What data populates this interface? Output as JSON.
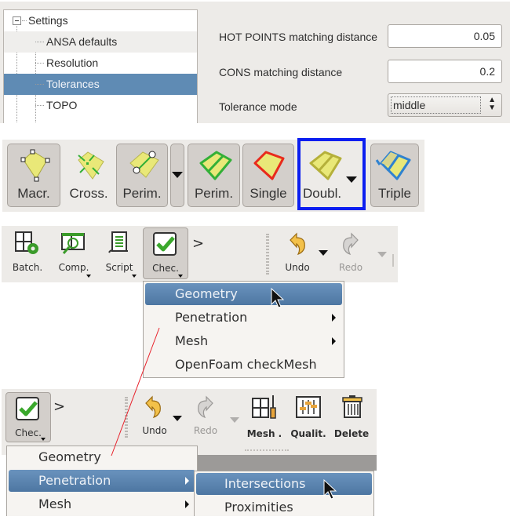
{
  "settings": {
    "tree": {
      "root": "Settings",
      "items": [
        {
          "label": "ANSA defaults",
          "selected": false
        },
        {
          "label": "Resolution",
          "selected": false
        },
        {
          "label": "Tolerances",
          "selected": true
        },
        {
          "label": "TOPO",
          "selected": false
        }
      ]
    },
    "form": {
      "hot_points_label": "HOT POINTS matching distance",
      "hot_points_value": "0.05",
      "cons_label": "CONS matching distance",
      "cons_value": "0.2",
      "tolerance_mode_label": "Tolerance mode",
      "tolerance_mode_value": "middle"
    }
  },
  "toolbar_topo": {
    "buttons": [
      {
        "label": "Macr.",
        "icon": "macro-face-icon",
        "pressed": true
      },
      {
        "label": "Cross.",
        "icon": "cross-face-icon",
        "pressed": false
      },
      {
        "label": "Perim.",
        "icon": "perimeter-points-icon",
        "pressed": true
      },
      {
        "label": "Perim.",
        "icon": "perimeter-icon",
        "pressed": true
      },
      {
        "label": "Single",
        "icon": "single-cons-icon",
        "pressed": true
      },
      {
        "label": "Doubl.",
        "icon": "double-cons-icon",
        "pressed": false,
        "highlighted": true
      },
      {
        "label": "Triple",
        "icon": "triple-cons-icon",
        "pressed": true
      }
    ],
    "highlight_color": "#0b1ef0"
  },
  "toolbar_checks_1": {
    "buttons": [
      {
        "label": "Batch.",
        "icon": "batch-mesh-icon"
      },
      {
        "label": "Comp.",
        "icon": "compare-icon"
      },
      {
        "label": "Script",
        "icon": "script-icon"
      },
      {
        "label": "Chec.",
        "icon": "checks-icon"
      }
    ],
    "more": ">",
    "undo": "Undo",
    "redo": "Redo",
    "menu": {
      "items": [
        {
          "label": "Geometry",
          "highlighted": true,
          "submenu": false
        },
        {
          "label": "Penetration",
          "highlighted": false,
          "submenu": true
        },
        {
          "label": "Mesh",
          "highlighted": false,
          "submenu": true
        },
        {
          "label": "OpenFoam checkMesh",
          "highlighted": false,
          "submenu": false
        }
      ]
    }
  },
  "toolbar_checks_2": {
    "chec": "Chec.",
    "more": ">",
    "undo": "Undo",
    "redo": "Redo",
    "mesh": "Mesh .",
    "qualit": "Qualit.",
    "delete": "Delete",
    "menu": {
      "items": [
        {
          "label": "Geometry",
          "highlighted": false,
          "submenu": false
        },
        {
          "label": "Penetration",
          "highlighted": true,
          "submenu": true
        },
        {
          "label": "Mesh",
          "highlighted": false,
          "submenu": true
        }
      ]
    },
    "submenu": {
      "items": [
        {
          "label": "Intersections",
          "highlighted": true
        },
        {
          "label": "Proximities",
          "highlighted": false
        }
      ]
    }
  },
  "annotation_color": "#e8202a"
}
